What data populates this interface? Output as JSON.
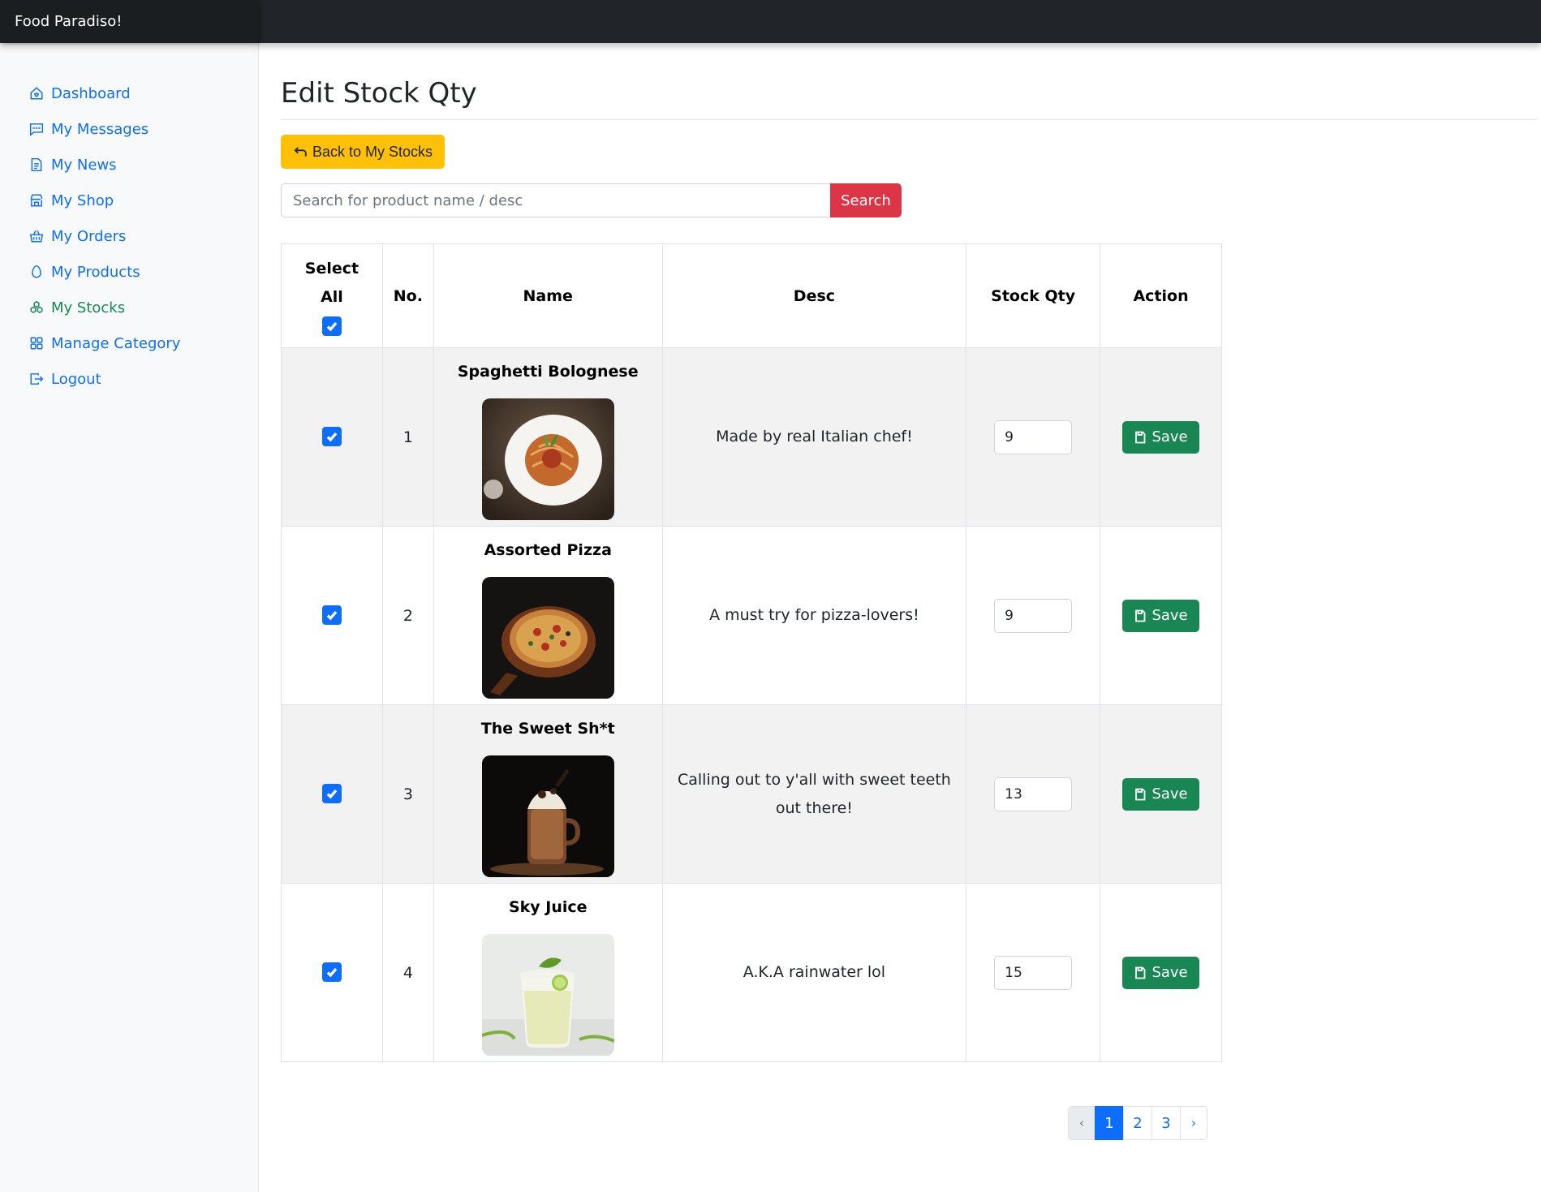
{
  "app": {
    "brand": "Food Paradiso!"
  },
  "sidebar": {
    "items": [
      {
        "label": "Dashboard",
        "icon": "house-heart-icon"
      },
      {
        "label": "My Messages",
        "icon": "chat-icon"
      },
      {
        "label": "My News",
        "icon": "newspaper-icon"
      },
      {
        "label": "My Shop",
        "icon": "shop-icon"
      },
      {
        "label": "My Orders",
        "icon": "basket-icon"
      },
      {
        "label": "My Products",
        "icon": "egg-icon"
      },
      {
        "label": "My Stocks",
        "icon": "boxes-icon",
        "active": true
      },
      {
        "label": "Manage Category",
        "icon": "grid-icon"
      },
      {
        "label": "Logout",
        "icon": "logout-icon"
      }
    ]
  },
  "page": {
    "title": "Edit Stock Qty",
    "back_label": "Back to My Stocks",
    "search": {
      "placeholder": "Search for product name / desc",
      "value": "",
      "button_label": "Search"
    }
  },
  "table": {
    "headers": {
      "select_line1": "Select",
      "select_line2": "All",
      "no": "No.",
      "name": "Name",
      "desc": "Desc",
      "qty": "Stock Qty",
      "action": "Action"
    },
    "select_all_checked": true,
    "save_label": "Save",
    "rows": [
      {
        "no": "1",
        "name": "Spaghetti Bolognese",
        "desc": "Made by real Italian chef!",
        "qty": "9",
        "checked": true,
        "image": "spaghetti-photo"
      },
      {
        "no": "2",
        "name": "Assorted Pizza",
        "desc": "A must try for pizza-lovers!",
        "qty": "9",
        "checked": true,
        "image": "pizza-photo"
      },
      {
        "no": "3",
        "name": "The Sweet Sh*t",
        "desc": "Calling out to y'all with sweet teeth out there!",
        "qty": "13",
        "checked": true,
        "image": "milkshake-photo"
      },
      {
        "no": "4",
        "name": "Sky Juice",
        "desc": "A.K.A rainwater lol",
        "qty": "15",
        "checked": true,
        "image": "lime-juice-photo"
      }
    ]
  },
  "pagination": {
    "prev": "‹",
    "pages": [
      "1",
      "2",
      "3"
    ],
    "current": "1",
    "next": "›"
  },
  "colors": {
    "primary": "#0d6efd",
    "success": "#198754",
    "warning": "#ffc107",
    "danger": "#dc3545",
    "topbar": "#212529"
  }
}
